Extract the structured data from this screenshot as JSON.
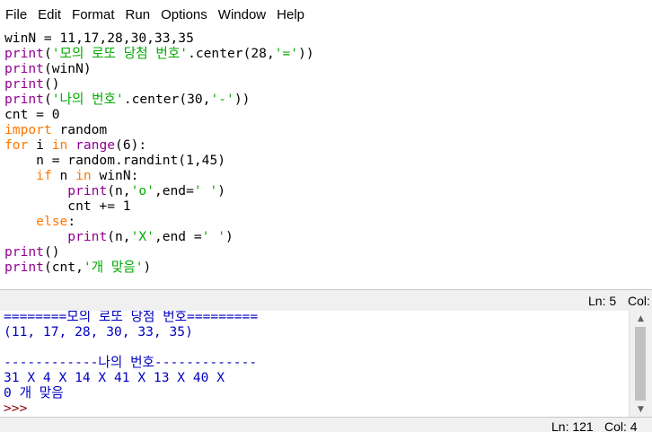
{
  "menu": [
    "File",
    "Edit",
    "Format",
    "Run",
    "Options",
    "Window",
    "Help"
  ],
  "editor": {
    "lines": [
      [
        {
          "t": "winN = 11,17,28,30,33,35",
          "c": "df"
        }
      ],
      [
        {
          "t": "print",
          "c": "bi"
        },
        {
          "t": "(",
          "c": "df"
        },
        {
          "t": "'모의 로또 당첨 번호'",
          "c": "str"
        },
        {
          "t": ".center(28,",
          "c": "df"
        },
        {
          "t": "'='",
          "c": "str"
        },
        {
          "t": "))",
          "c": "df"
        }
      ],
      [
        {
          "t": "print",
          "c": "bi"
        },
        {
          "t": "(winN)",
          "c": "df"
        }
      ],
      [
        {
          "t": "print",
          "c": "bi"
        },
        {
          "t": "()",
          "c": "df"
        }
      ],
      [
        {
          "t": "print",
          "c": "bi"
        },
        {
          "t": "(",
          "c": "df"
        },
        {
          "t": "'나의 번호'",
          "c": "str"
        },
        {
          "t": ".center(30,",
          "c": "df"
        },
        {
          "t": "'-'",
          "c": "str"
        },
        {
          "t": "))",
          "c": "df"
        }
      ],
      [
        {
          "t": "cnt = 0",
          "c": "df"
        }
      ],
      [
        {
          "t": "import",
          "c": "kw"
        },
        {
          "t": " random",
          "c": "df"
        }
      ],
      [
        {
          "t": "for",
          "c": "kw"
        },
        {
          "t": " i ",
          "c": "df"
        },
        {
          "t": "in",
          "c": "kw"
        },
        {
          "t": " ",
          "c": "df"
        },
        {
          "t": "range",
          "c": "bi"
        },
        {
          "t": "(6):",
          "c": "df"
        }
      ],
      [
        {
          "t": "    n = random.randint(1,45)",
          "c": "df"
        }
      ],
      [
        {
          "t": "    ",
          "c": "df"
        },
        {
          "t": "if",
          "c": "kw"
        },
        {
          "t": " n ",
          "c": "df"
        },
        {
          "t": "in",
          "c": "kw"
        },
        {
          "t": " winN:",
          "c": "df"
        }
      ],
      [
        {
          "t": "        ",
          "c": "df"
        },
        {
          "t": "print",
          "c": "bi"
        },
        {
          "t": "(n,",
          "c": "df"
        },
        {
          "t": "'o'",
          "c": "str"
        },
        {
          "t": ",end=",
          "c": "df"
        },
        {
          "t": "' '",
          "c": "str"
        },
        {
          "t": ")",
          "c": "df"
        }
      ],
      [
        {
          "t": "        cnt += 1",
          "c": "df"
        }
      ],
      [
        {
          "t": "    ",
          "c": "df"
        },
        {
          "t": "else",
          "c": "kw"
        },
        {
          "t": ":",
          "c": "df"
        }
      ],
      [
        {
          "t": "        ",
          "c": "df"
        },
        {
          "t": "print",
          "c": "bi"
        },
        {
          "t": "(n,",
          "c": "df"
        },
        {
          "t": "'X'",
          "c": "str"
        },
        {
          "t": ",end =",
          "c": "df"
        },
        {
          "t": "' '",
          "c": "str"
        },
        {
          "t": ")",
          "c": "df"
        }
      ],
      [
        {
          "t": "print",
          "c": "bi"
        },
        {
          "t": "()",
          "c": "df"
        }
      ],
      [
        {
          "t": "print",
          "c": "bi"
        },
        {
          "t": "(cnt,",
          "c": "df"
        },
        {
          "t": "'개 맞음'",
          "c": "str"
        },
        {
          "t": ")",
          "c": "df"
        }
      ]
    ],
    "status": {
      "ln": "Ln: 5",
      "col": "Col:"
    }
  },
  "shell": {
    "lines": [
      {
        "t": "========모의 로또 당첨 번호=========",
        "c": "out"
      },
      {
        "t": "(11, 17, 28, 30, 33, 35)",
        "c": "out"
      },
      {
        "t": "",
        "c": "out"
      },
      {
        "t": "------------나의 번호-------------",
        "c": "out"
      },
      {
        "t": "31 X 4 X 14 X 41 X 13 X 40 X",
        "c": "out"
      },
      {
        "t": "0 개 맞음",
        "c": "out"
      },
      {
        "t": ">>>",
        "c": "prompt"
      }
    ],
    "status": {
      "ln": "Ln: 121",
      "col": "Col: 4"
    }
  },
  "colors": {
    "keyword": "#ff7700",
    "string": "#00aa00",
    "builtin": "#900090",
    "output": "#0000c0",
    "prompt": "#8b0000"
  },
  "icons": {
    "scroll_up": "triangle-up-icon",
    "scroll_down": "triangle-down-icon"
  }
}
